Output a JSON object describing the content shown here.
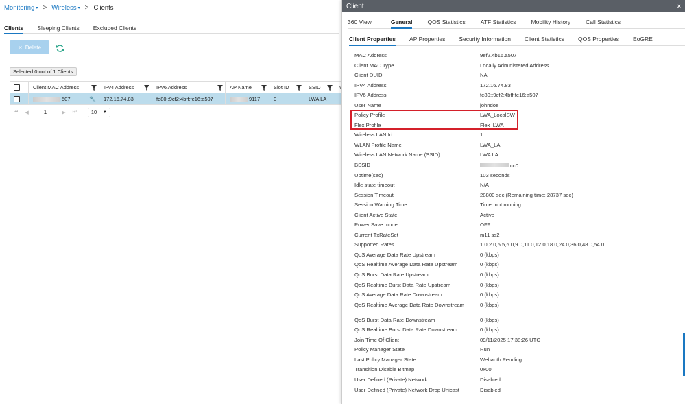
{
  "breadcrumb": {
    "items": [
      "Monitoring",
      "Wireless"
    ],
    "current": "Clients",
    "separator": ">"
  },
  "left_tabs": [
    "Clients",
    "Sleeping Clients",
    "Excluded Clients"
  ],
  "toolbar": {
    "delete_label": "Delete"
  },
  "selection_text": "Selected 0 out of 1 Clients",
  "table": {
    "columns": [
      "Client MAC Address",
      "IPv4 Address",
      "IPv6 Address",
      "AP Name",
      "Slot ID",
      "SSID",
      "W"
    ],
    "rows": [
      {
        "mac": "507",
        "ipv4": "172.16.74.83",
        "ipv6": "fe80::9cf2:4bff:fe16:a507",
        "ap": "9117",
        "slot": "0",
        "ssid": "LWA LA"
      }
    ]
  },
  "pager": {
    "page": "1",
    "page_size": "10"
  },
  "panel": {
    "title": "Client",
    "close_glyph": "×",
    "tabs": [
      "360 View",
      "General",
      "QOS Statistics",
      "ATF Statistics",
      "Mobility History",
      "Call Statistics"
    ],
    "active_tab": "General",
    "subtabs": [
      "Client Properties",
      "AP Properties",
      "Security Information",
      "Client Statistics",
      "QOS Properties",
      "EoGRE"
    ],
    "active_subtab": "Client Properties",
    "properties": [
      {
        "k": "MAC Address",
        "v": "9ef2.4b16.a507"
      },
      {
        "k": "Client MAC Type",
        "v": "Locally Administered Address"
      },
      {
        "k": "Client DUID",
        "v": "NA"
      },
      {
        "k": "IPV4 Address",
        "v": "172.16.74.83"
      },
      {
        "k": "IPV6 Address",
        "v": "fe80::9cf2:4bff:fe16:a507"
      },
      {
        "k": "User Name",
        "v": "johndoe"
      },
      {
        "k": "Policy Profile",
        "v": "LWA_LocalSW"
      },
      {
        "k": "Flex Profile",
        "v": "Flex_LWA"
      },
      {
        "k": "Wireless LAN Id",
        "v": "1"
      },
      {
        "k": "WLAN Profile Name",
        "v": "LWA_LA"
      },
      {
        "k": "Wireless LAN Network Name (SSID)",
        "v": "LWA LA"
      },
      {
        "k": "BSSID",
        "v": "cc0"
      },
      {
        "k": "Uptime(sec)",
        "v": "103 seconds"
      },
      {
        "k": "Idle state timeout",
        "v": "N/A"
      },
      {
        "k": "Session Timeout",
        "v": "28800 sec (Remaining time: 28737 sec)"
      },
      {
        "k": "Session Warning Time",
        "v": "Timer not running"
      },
      {
        "k": "Client Active State",
        "v": "Active"
      },
      {
        "k": "Power Save mode",
        "v": "OFF"
      },
      {
        "k": "Current TxRateSet",
        "v": "m11 ss2"
      },
      {
        "k": "Supported Rates",
        "v": "1.0,2.0,5.5,6.0,9.0,11.0,12.0,18.0,24.0,36.0,48.0,54.0"
      },
      {
        "k": "QoS Average Data Rate Upstream",
        "v": "0 (kbps)"
      },
      {
        "k": "QoS Realtime Average Data Rate Upstream",
        "v": "0 (kbps)"
      },
      {
        "k": "QoS Burst Data Rate Upstream",
        "v": "0 (kbps)"
      },
      {
        "k": "QoS Realtime Burst Data Rate Upstream",
        "v": "0 (kbps)"
      },
      {
        "k": "QoS Average Data Rate Downstream",
        "v": "0 (kbps)"
      },
      {
        "k": "QoS Realtime Average Data Rate Downstream",
        "v": "0 (kbps)",
        "tall": true
      },
      {
        "k": "QoS Burst Data Rate Downstream",
        "v": "0 (kbps)"
      },
      {
        "k": "QoS Realtime Burst Data Rate Downstream",
        "v": "0 (kbps)"
      },
      {
        "k": "Join Time Of Client",
        "v": "09/11/2025 17:38:26 UTC"
      },
      {
        "k": "Policy Manager State",
        "v": "Run"
      },
      {
        "k": "Last Policy Manager State",
        "v": "Webauth Pending"
      },
      {
        "k": "Transition Disable Bitmap",
        "v": "0x00"
      },
      {
        "k": "User Defined (Private) Network",
        "v": "Disabled"
      },
      {
        "k": "User Defined (Private) Network Drop Unicast",
        "v": "Disabled",
        "tall": true
      }
    ]
  },
  "colors": {
    "accent": "#1a78c2",
    "panel_header": "#5a5f66",
    "selected_row": "#bcdcec",
    "highlight_box": "#d4202a"
  }
}
